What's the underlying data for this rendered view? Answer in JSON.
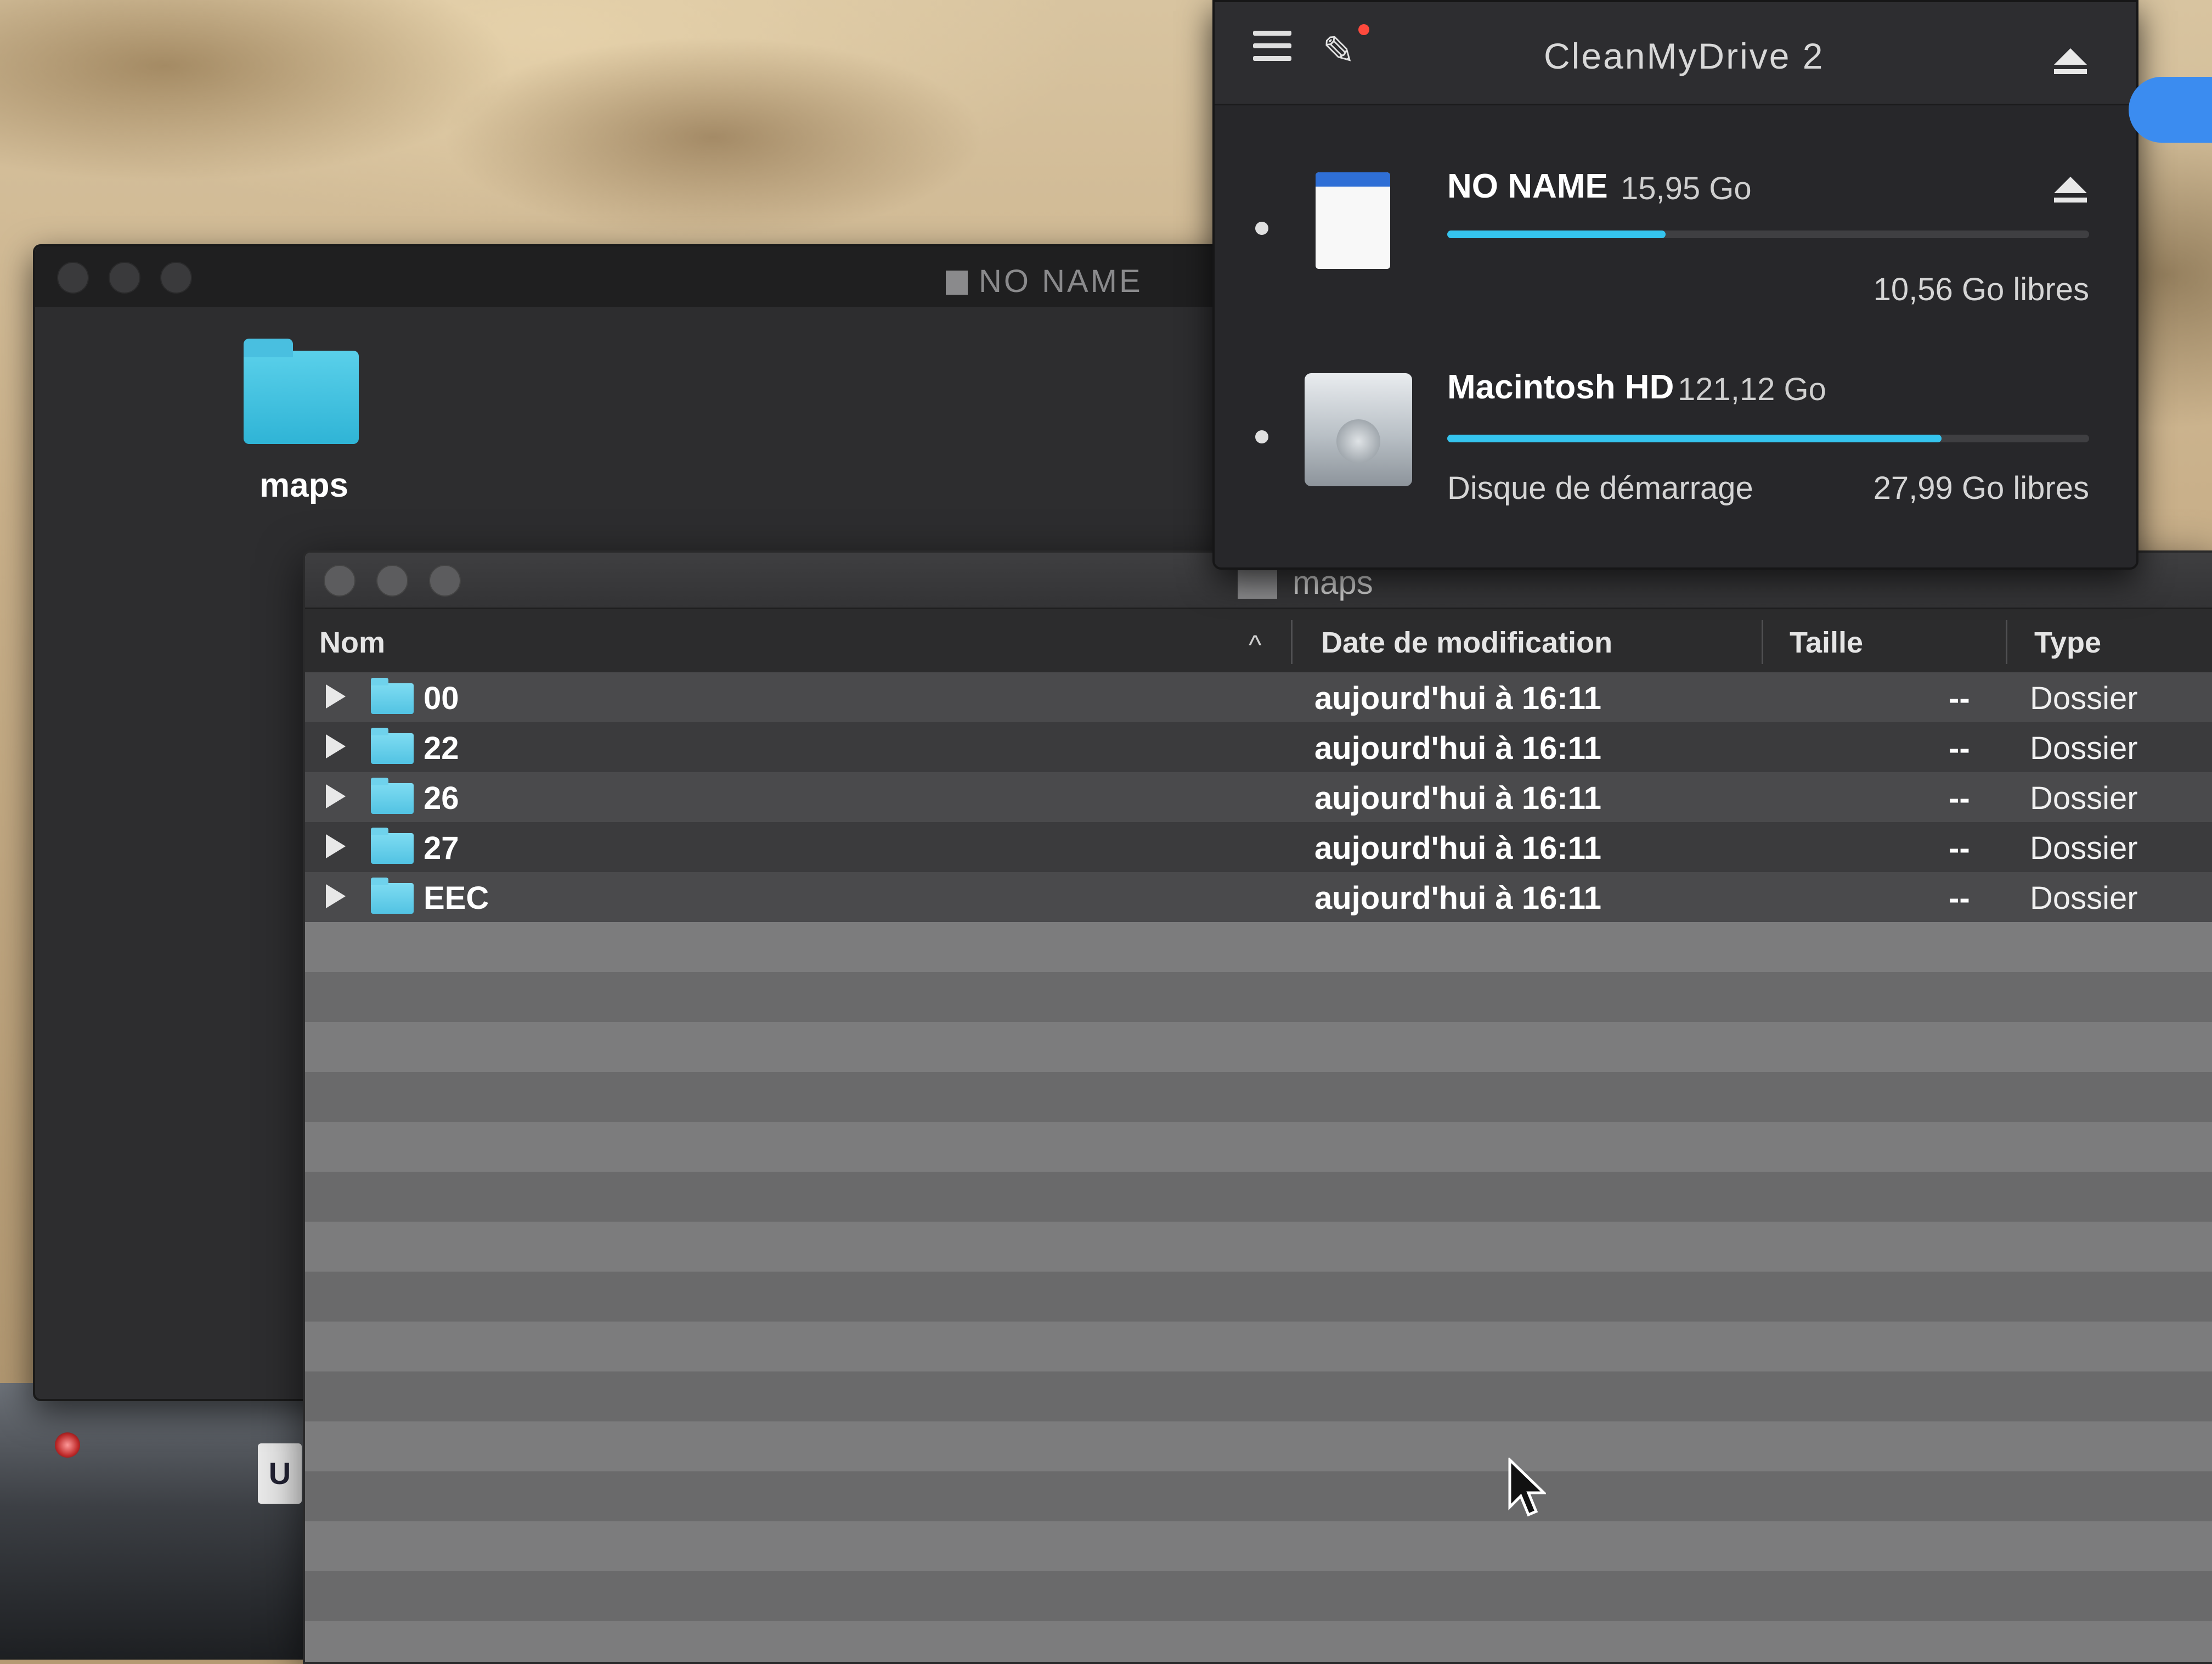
{
  "colors": {
    "accent_folder": "#52c3e3",
    "progress_fill": "#35c4ee",
    "popover_bg": "#27272a",
    "finder_header": "#2c2c2d"
  },
  "back_window": {
    "title": "NO NAME",
    "desktop_item": {
      "label": "maps",
      "icon": "folder-icon"
    }
  },
  "front_window": {
    "title": "maps",
    "columns": {
      "name": "Nom",
      "date": "Date de modification",
      "size": "Taille",
      "kind": "Type"
    },
    "sort_indicator": "^",
    "rows": [
      {
        "name": "00",
        "date": "aujourd'hui à 16:11",
        "size": "--",
        "kind": "Dossier"
      },
      {
        "name": "22",
        "date": "aujourd'hui à 16:11",
        "size": "--",
        "kind": "Dossier"
      },
      {
        "name": "26",
        "date": "aujourd'hui à 16:11",
        "size": "--",
        "kind": "Dossier"
      },
      {
        "name": "27",
        "date": "aujourd'hui à 16:11",
        "size": "--",
        "kind": "Dossier"
      },
      {
        "name": "EEC",
        "date": "aujourd'hui à 16:11",
        "size": "--",
        "kind": "Dossier"
      }
    ]
  },
  "cleanmydrive": {
    "title": "CleanMyDrive 2",
    "drives": [
      {
        "name": "NO NAME",
        "capacity": "15,95 Go",
        "free": "10,56 Go libres",
        "used_fraction": 0.34,
        "icon": "sd-card-icon"
      },
      {
        "name": "Macintosh HD",
        "capacity": "121,12 Go",
        "subtitle": "Disque de démarrage",
        "free": "27,99 Go libres",
        "used_fraction": 0.77,
        "icon": "hard-drive-icon"
      }
    ]
  },
  "desk_plate": "U"
}
